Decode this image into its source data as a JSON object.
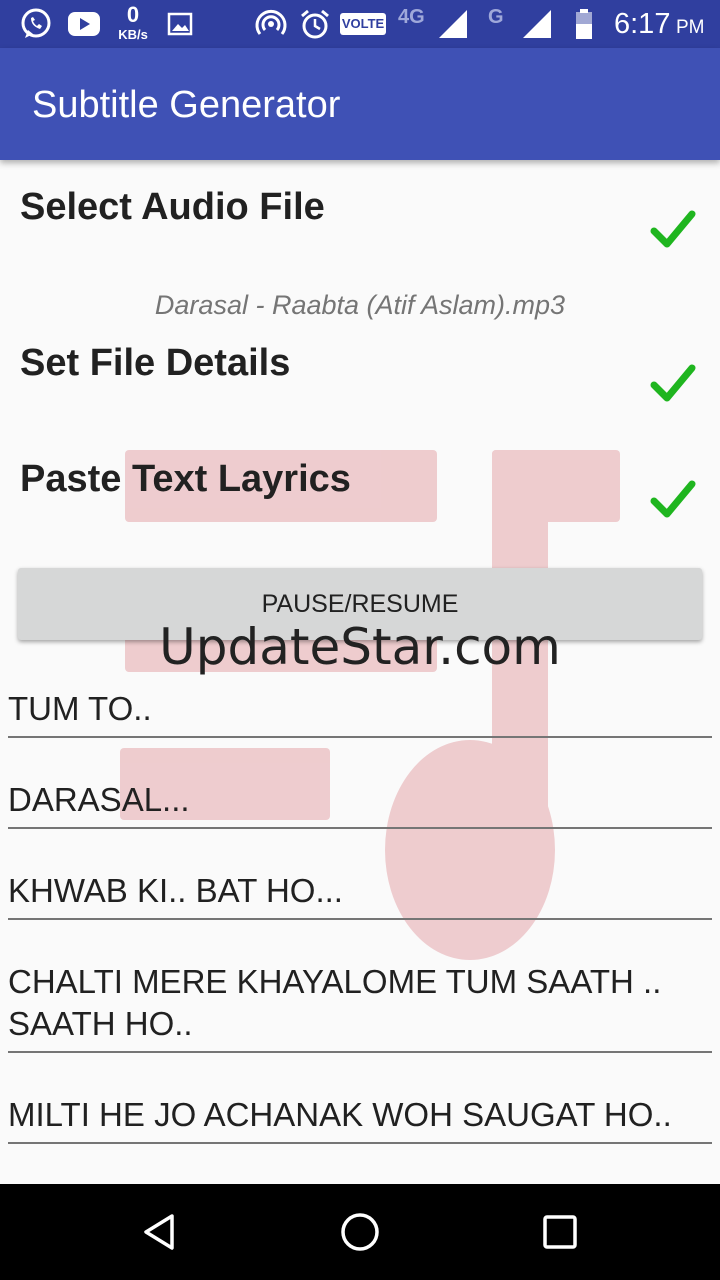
{
  "status_bar": {
    "network_speed_value": "0",
    "network_speed_unit": "KB/s",
    "volte": "VOLTE",
    "network_type": "4G",
    "network_type_2": "G",
    "time": "6:17",
    "ampm": "PM"
  },
  "app_bar": {
    "title": "Subtitle Generator"
  },
  "steps": [
    {
      "label": "Select Audio File",
      "completed": true
    },
    {
      "label": "Set File Details",
      "completed": true
    },
    {
      "label": "Paste Text Layrics",
      "completed": true
    }
  ],
  "selected_file": "Darasal - Raabta (Atif Aslam).mp3",
  "pause_resume_button": "PAUSE/RESUME",
  "watermark_text": "UpdateStar.com",
  "lyrics": [
    "TUM TO..",
    "DARASAL...",
    "KHWAB KI.. BAT HO...",
    "CHALTI MERE KHAYALOME TUM SAATH .. SAATH HO..",
    "MILTI HE JO ACHANAK WOH SAUGAT HO.."
  ],
  "colors": {
    "status_bar": "#303f9f",
    "app_bar": "#3f51b5",
    "check": "#1fb51f",
    "watermark": "#e8b4b8"
  },
  "icons": {
    "nav_back": "triangle-back-icon",
    "nav_home": "circle-home-icon",
    "nav_recents": "square-recents-icon"
  }
}
